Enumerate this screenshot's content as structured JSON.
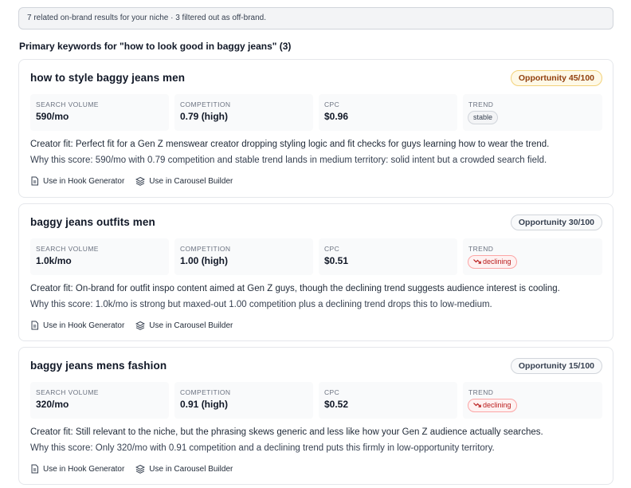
{
  "banner": {
    "text": "7 related on-brand results for your niche · 3 filtered out as off-brand."
  },
  "section": {
    "title": "Primary keywords for \"how to look good in baggy jeans\" (3)"
  },
  "labels": {
    "search_volume": "SEARCH VOLUME",
    "competition": "COMPETITION",
    "cpc": "CPC",
    "trend": "TREND",
    "hook_generator": "Use in Hook Generator",
    "carousel_builder": "Use in Carousel Builder"
  },
  "colors": {
    "opportunity_high": "#fef9e7",
    "declining": "#b91c1c",
    "accent_text": "#92400e"
  },
  "cards": [
    {
      "keyword": "how to style baggy jeans men",
      "opportunity": "Opportunity 45/100",
      "search_volume": "590/mo",
      "competition": "0.79 (high)",
      "cpc": "$0.96",
      "trend": "stable",
      "trend_icon": "",
      "creator_fit": "Creator fit: Perfect fit for a Gen Z menswear creator dropping styling logic and fit checks for guys learning how to wear the trend.",
      "why": "Why this score: 590/mo with 0.79 competition and stable trend lands in medium territory: solid intent but a crowded search field."
    },
    {
      "keyword": "baggy jeans outfits men",
      "opportunity": "Opportunity 30/100",
      "search_volume": "1.0k/mo",
      "competition": "1.00 (high)",
      "cpc": "$0.51",
      "trend": "declining",
      "trend_icon": "trend-down-icon",
      "creator_fit": "Creator fit: On-brand for outfit inspo content aimed at Gen Z guys, though the declining trend suggests audience interest is cooling.",
      "why": "Why this score: 1.0k/mo is strong but maxed-out 1.00 competition plus a declining trend drops this to low-medium."
    },
    {
      "keyword": "baggy jeans mens fashion",
      "opportunity": "Opportunity 15/100",
      "search_volume": "320/mo",
      "competition": "0.91 (high)",
      "cpc": "$0.52",
      "trend": "declining",
      "trend_icon": "trend-down-icon",
      "creator_fit": "Creator fit: Still relevant to the niche, but the phrasing skews generic and less like how your Gen Z audience actually searches.",
      "why": "Why this score: Only 320/mo with 0.91 competition and a declining trend puts this firmly in low-opportunity territory."
    }
  ]
}
